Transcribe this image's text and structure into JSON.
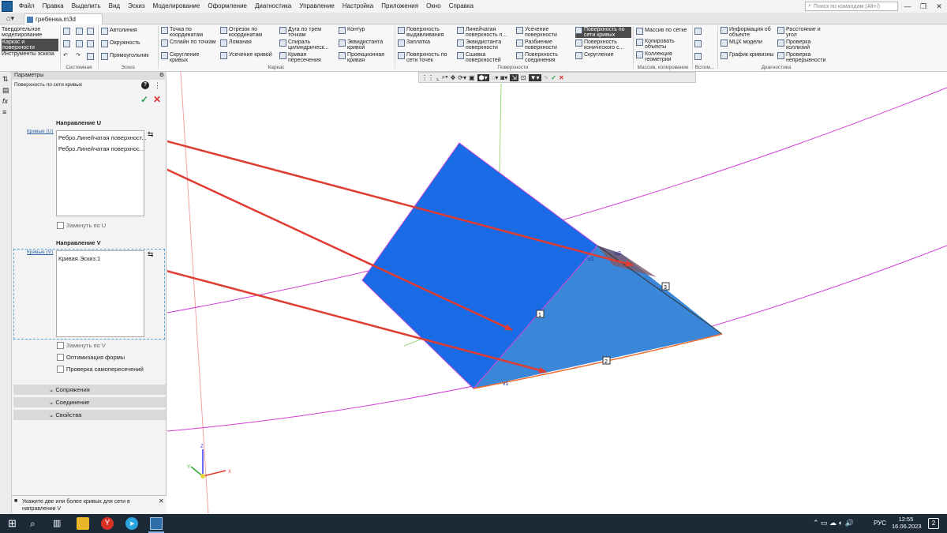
{
  "app": {
    "menu": [
      "Файл",
      "Правка",
      "Выделить",
      "Вид",
      "Эскиз",
      "Моделирование",
      "Оформление",
      "Диагностика",
      "Управление",
      "Настройка",
      "Приложения",
      "Окно",
      "Справка"
    ],
    "search_placeholder": "Поиск по командам (Alt+/)",
    "tab_title": "гребенка.m3d"
  },
  "ribbon": {
    "modes": [
      "Твердотельное моделирование",
      "Каркас и поверхности",
      "Инструменты эскиза"
    ],
    "system_label": "Системная",
    "sketch": {
      "items": [
        "Автолиния",
        "Окружность",
        "Прямоугольник"
      ],
      "label": "Эскиз"
    },
    "frame": {
      "items": [
        "Точка по координатам",
        "Сплайн по точкам",
        "Скругление кривых",
        "Отрезок по координатам",
        "Ломаная",
        "Усечение кривой",
        "Дуга по трем точкам",
        "Спираль цилиндрическ...",
        "Кривая пересечения",
        "Контур",
        "Эквидистанта кривой",
        "Проекционная кривая"
      ],
      "label": "Каркас"
    },
    "surfaces": {
      "items": [
        "Поверхность выдавливания",
        "Заплатка",
        "Поверхность по сети точек",
        "Линейчатая поверхность п...",
        "Эквидистанта поверхности",
        "Сшивка поверхностей",
        "Усечение поверхности",
        "Разбиение поверхности",
        "Поверхность соединения",
        "Поверхность по сети кривых",
        "Поверхность конического с...",
        "Скругление"
      ],
      "label": "Поверхности"
    },
    "array": {
      "items": [
        "Массив по сетке",
        "Копировать объекты",
        "Коллекция геометрии"
      ],
      "label": "Массив, копирование"
    },
    "aux_label": "Вспом...",
    "diag": {
      "items": [
        "Информация об объекте",
        "МЦХ модели",
        "График кривизны",
        "Расстояние и угол",
        "Проверка коллизий",
        "Проверка непрерывности"
      ],
      "label": "Диагностика"
    }
  },
  "panel": {
    "title": "Параметры",
    "subtitle": "Поверхность по сети кривых",
    "dir_u": "Направление U",
    "curves_u_label": "Кривые (U)",
    "curves_u": [
      "Ребро.Линейчатая поверхност...",
      "Ребро.Линейчатая поверхнос..."
    ],
    "closed_u": "Замкнуть по U",
    "dir_v": "Направление V",
    "curves_v_label": "Кривые (V)",
    "curves_v": [
      "Кривая.Эскиз:1"
    ],
    "closed_v": "Замкнуть по V",
    "optimize": "Оптимизация формы",
    "selfcheck": "Проверка самопересечений",
    "sections": [
      "Сопряжения",
      "Соединение",
      "Свойства"
    ],
    "hint": "Укажите две или более кривых для сети в направлении V"
  },
  "viewport": {
    "labels": {
      "u1": "u1",
      "u2": "u2",
      "v1": "v1",
      "n1": "1",
      "n2": "2",
      "n3": "3"
    },
    "axes": {
      "x": "X",
      "y": "Y",
      "z": "Z"
    },
    "colors": {
      "face_dark": "#1a6be6",
      "face_light": "#3a86d8",
      "arrow": "#e03c31",
      "magenta": "#d63cd6",
      "edge_orange": "#f06a2a"
    }
  },
  "taskbar": {
    "lang": "РУС",
    "time": "12:55",
    "date": "16.06.2023",
    "notif": "2"
  }
}
